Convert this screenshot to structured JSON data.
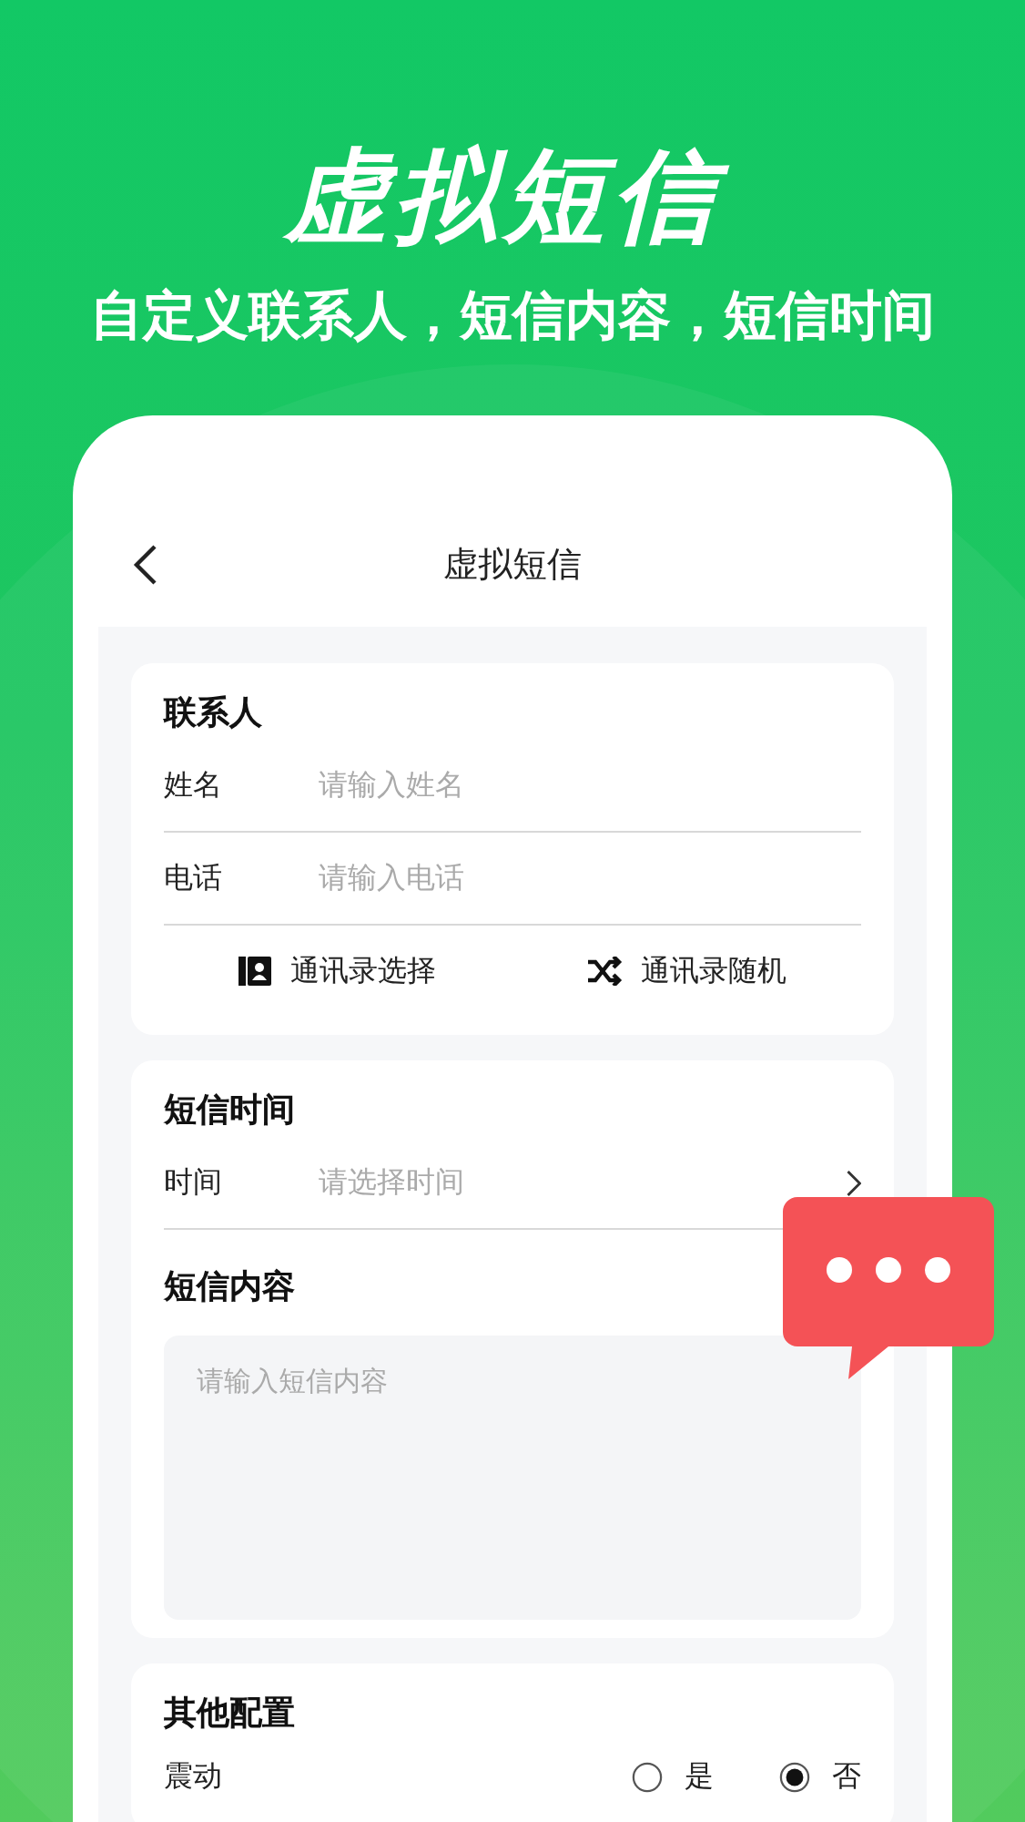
{
  "banner": {
    "title": "虚拟短信",
    "subtitle": "自定义联系人，短信内容，短信时间"
  },
  "nav": {
    "title": "虚拟短信"
  },
  "contact": {
    "heading": "联系人",
    "fields": [
      {
        "label": "姓名",
        "placeholder": "请输入姓名"
      },
      {
        "label": "电话",
        "placeholder": "请输入电话"
      }
    ],
    "actions": [
      {
        "kind": "contacts",
        "label": "通讯录选择"
      },
      {
        "kind": "shuffle",
        "label": "通讯录随机"
      }
    ]
  },
  "time": {
    "heading": "短信时间",
    "label": "时间",
    "placeholder": "请选择时间"
  },
  "content": {
    "heading": "短信内容",
    "placeholder": "请输入短信内容"
  },
  "other": {
    "heading": "其他配置",
    "label": "震动",
    "options": [
      {
        "label": "是",
        "selected": false
      },
      {
        "label": "否",
        "selected": true
      }
    ]
  }
}
